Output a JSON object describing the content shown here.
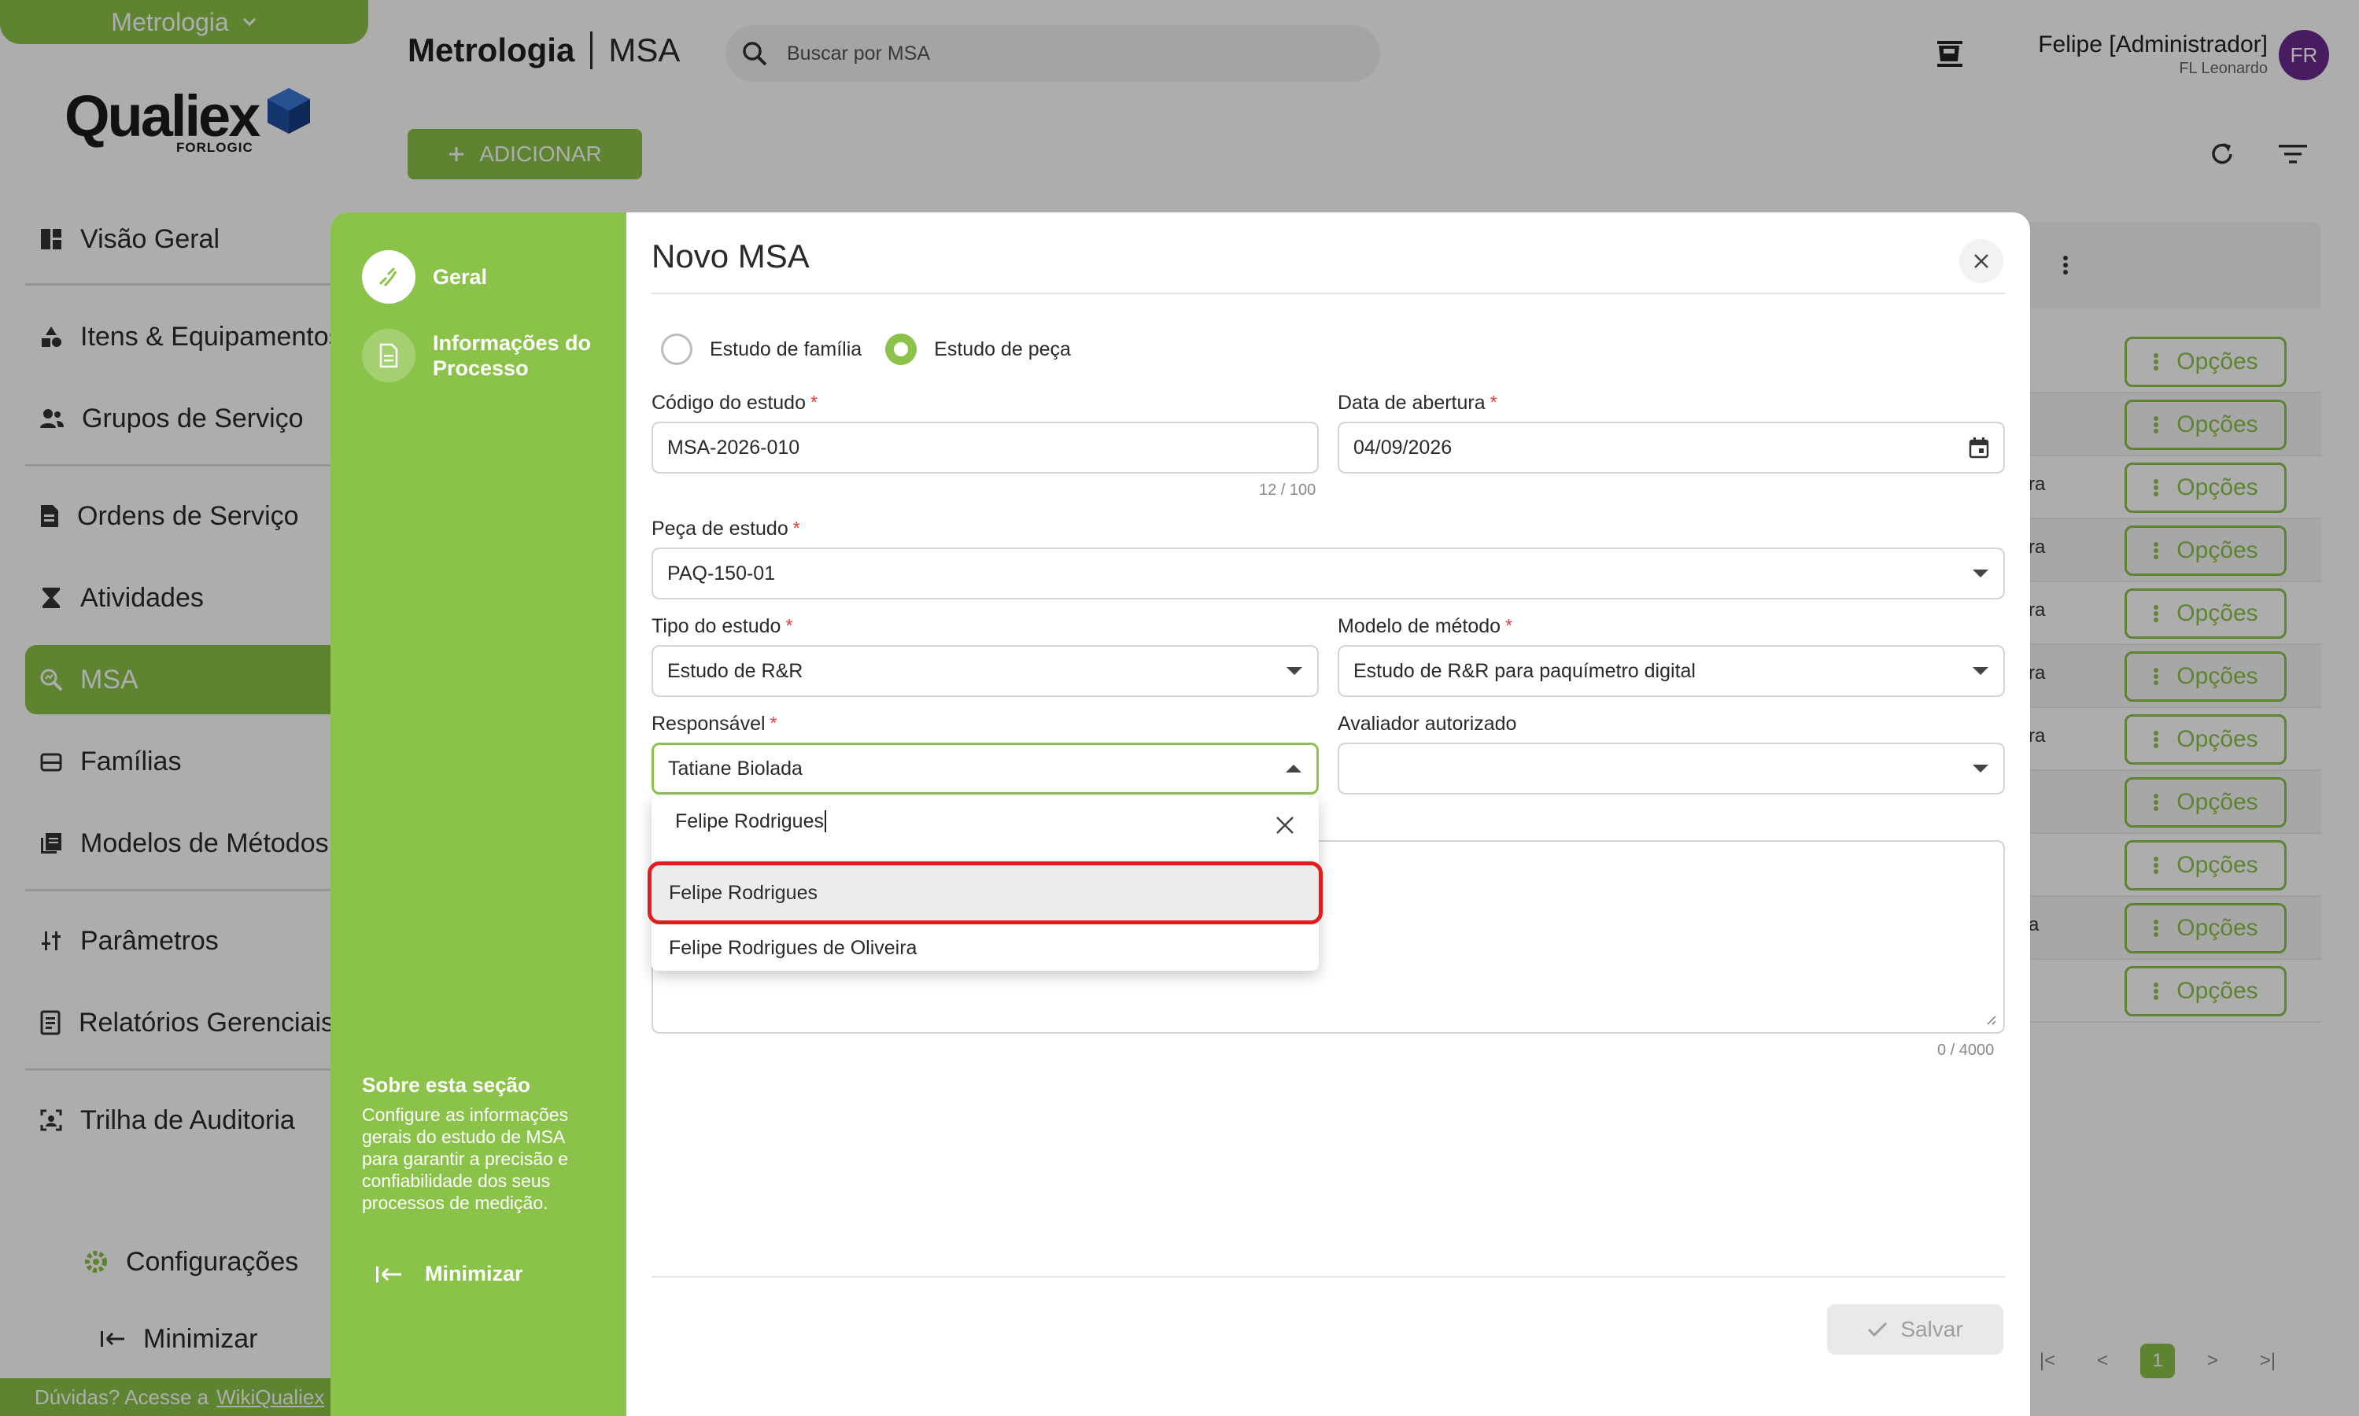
{
  "sidebar": {
    "module": "Metrologia",
    "logo": {
      "name": "Qualiex",
      "sub": "FORLOGIC"
    },
    "items": [
      {
        "label": "Visão Geral",
        "icon": "dashboard-icon"
      },
      {
        "label": "Itens & Equipamentos",
        "icon": "shapes-icon"
      },
      {
        "label": "Grupos de Serviço",
        "icon": "group-icon"
      },
      {
        "label": "Ordens de Serviço",
        "icon": "document-icon"
      },
      {
        "label": "Atividades",
        "icon": "hourglass-icon"
      },
      {
        "label": "MSA",
        "icon": "search-analytics-icon"
      },
      {
        "label": "Famílias",
        "icon": "archive-icon"
      },
      {
        "label": "Modelos de Métodos",
        "icon": "library-icon"
      },
      {
        "label": "Parâmetros",
        "icon": "sliders-icon"
      },
      {
        "label": "Relatórios Gerenciais",
        "icon": "report-icon"
      },
      {
        "label": "Trilha de Auditoria",
        "icon": "audit-icon"
      }
    ],
    "settings_label": "Configurações",
    "minimize_label": "Minimizar",
    "help_text": "Dúvidas? Acesse a",
    "help_link": "WikiQualiex"
  },
  "header": {
    "module": "Metrologia",
    "page": "MSA",
    "search_placeholder": "Buscar por MSA",
    "user_name": "Felipe [Administrador]",
    "user_sub": "FL Leonardo",
    "avatar_initials": "FR"
  },
  "toolbar": {
    "add_label": "ADICIONAR"
  },
  "list": {
    "option_label": "Opções",
    "row_fragments": [
      "",
      "",
      "ra",
      "ra",
      "ra",
      "ra",
      "ra",
      "",
      "",
      "a",
      ""
    ],
    "current_page": "1"
  },
  "modal": {
    "title": "Novo MSA",
    "steps": [
      {
        "label": "Geral"
      },
      {
        "label": "Informações do Processo"
      }
    ],
    "about_title": "Sobre esta seção",
    "about_text": "Configure as informações gerais do estudo de MSA para garantir a precisão e confiabilidade dos seus processos de medição.",
    "minimize_label": "Minimizar",
    "radio": {
      "option1": "Estudo de família",
      "option2": "Estudo de peça",
      "selected": "Estudo de peça"
    },
    "fields": {
      "codigo": {
        "label": "Código do estudo",
        "value": "MSA-2026-010",
        "counter": "12 / 100"
      },
      "data": {
        "label": "Data de abertura",
        "value": "04/09/2026"
      },
      "peca": {
        "label": "Peça de estudo",
        "value": "PAQ-150-01"
      },
      "tipo": {
        "label": "Tipo do estudo",
        "value": "Estudo de R&R"
      },
      "modelo": {
        "label": "Modelo de método",
        "value": "Estudo de R&R para paquímetro digital"
      },
      "responsavel": {
        "label": "Responsável",
        "value": "Tatiane Biolada"
      },
      "avaliador": {
        "label": "Avaliador autorizado",
        "value": ""
      },
      "textarea_counter": "0 / 4000"
    },
    "dropdown": {
      "search_value": "Felipe Rodrigues",
      "options": [
        "Felipe Rodrigues",
        "Felipe Rodrigues de Oliveira"
      ],
      "highlighted": "Felipe Rodrigues"
    },
    "save_label": "Salvar"
  },
  "colors": {
    "accent": "#8bc34a",
    "avatar": "#6a2a8e",
    "highlight_border": "#e01e1e",
    "required": "#e53935"
  }
}
